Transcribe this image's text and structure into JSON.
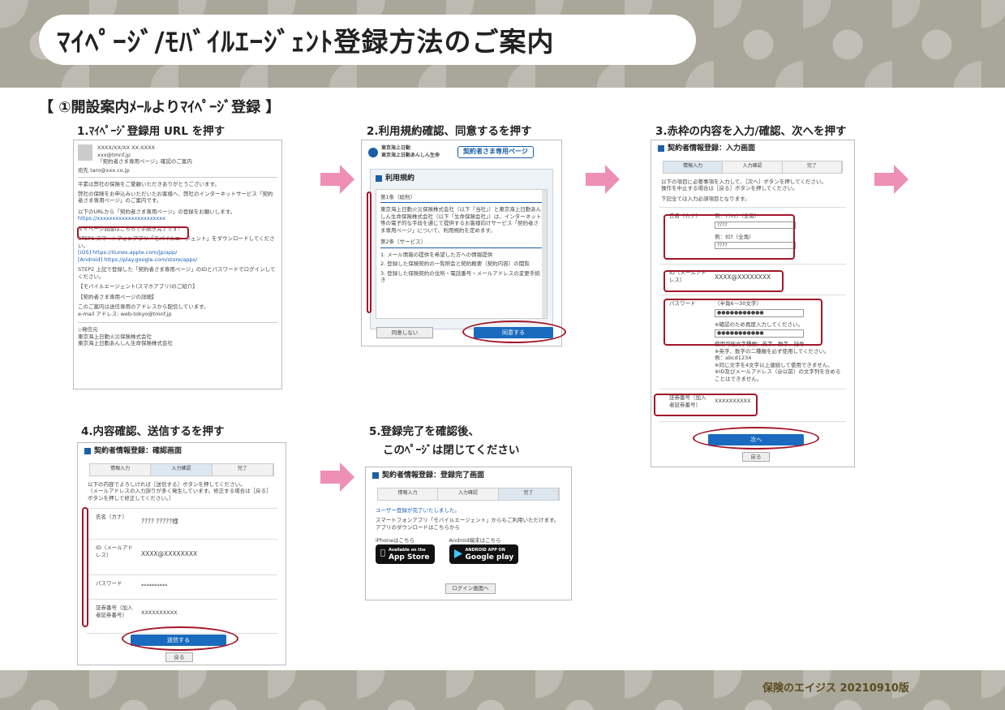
{
  "title": "ﾏｲﾍﾟｰｼﾞ/ﾓﾊﾞｲﾙｴｰｼﾞｪﾝﾄ登録方法のご案内",
  "section": "【 ①開設案内ﾒｰﾙよりﾏｲﾍﾟｰｼﾞ登録 】",
  "steps": [
    "1.ﾏｲﾍﾟｰｼﾞ登録用 URL を押す",
    "2.利用規約確認、同意するを押す",
    "3.赤枠の内容を入力/確認、次へを押す",
    "4.内容確認、送信するを押す",
    "5.登録完了を確認後、",
    "このﾍﾟｰｼﾞは閉じてください"
  ],
  "footer": "保険のエイジス 20210910版",
  "colors": {
    "band": "#a9a79a",
    "arrow": "#ee8fb6",
    "ring": "#a3162a",
    "button": "#1a6bbf"
  },
  "email": {
    "date": "XXXX/XX/XX XX:XXXX",
    "from": "xxx@tmnf.jp",
    "subject": "「契約者さま専用ページ」確認のご案内",
    "to_label": "宛先",
    "to": "taro@xxx.co.jp",
    "body1": "平素は弊社の保険をご愛顧いただきありがとうございます。",
    "body2": "弊社の保険をお申込みいただいたお客様へ、弊社のインターネットサービス「契約者さま専用ページ」のご案内です。",
    "url_intro": "以下のURLから「契約者さま専用ページ」の登録をお願いします。",
    "url": "https://xxxxxxxxxxxxxxxxxxxxxx",
    "mypage": "マイページ開設はこちらで手続き完了です！",
    "step1": "STEP1 スマートフォンアプリ「モバイルエージェント」をダウンロードしてください。",
    "ios": "[iOS] https://itunes.apple.com/jp/app/",
    "android": "[Android] https://play.google.com/store/apps/",
    "step2": "STEP2 上記で登録した「契約者さま専用ページ」のIDとパスワードでログインしてください。",
    "mobile": "【モバイルエージェント(スマホアプリ)のご紹介】",
    "detail": "【契約者さま専用ページの詳細】",
    "note": "このご案内は送信専用のアドレスから配信しています。",
    "email_line": "e-mail アドレス: web-tokyo@tmnf.jp",
    "sender_label": "◇発信元",
    "sender1": "東京海上日動火災保険株式会社",
    "sender2": "東京海上日動あんしん生命保険株式会社"
  },
  "terms": {
    "logo1": "東京海上日動",
    "logo2": "東京海上日動あんしん生命",
    "banner": "契約者さま専用ページ",
    "heading": "利用規約",
    "art1": "第1条（総則）",
    "text1": "東京海上日動火災保険株式会社（以下「当社」）と東京海上日動あんしん生命保険株式会社（以下「生命保険会社」）は、インターネット等の電子的な手段を通じて提供するお客様向けサービス「契約者さま専用ページ」について、利用規約を定めます。",
    "art2": "第2条（サービス）",
    "text2a": "1. メール情報の提供を希望した方への情報提供",
    "text2b": "2. 登録した保険契約の一覧照会と契約概要（契約内容）の閲覧",
    "text2c": "3. 登録した保険契約の住所・電話番号・メールアドレスの変更手続き",
    "disagree": "同意しない",
    "agree": "同意する"
  },
  "form": {
    "heading": "契約者情報登録：入力画面",
    "tabs": [
      "情報入力",
      "入力確認",
      "完了"
    ],
    "intro": "以下の項目に必要事項を入力して、［次へ］ボタンを押してください。",
    "intro2": "操作を中止する場合は［戻る］ボタンを押してください。",
    "required": "下記全ては入力必須項目となります。",
    "name_label": "氏名（カナ）",
    "ex1": "例：ﾄｳｷｮｳ（全角）",
    "ex2": "例：ﾀﾛｳ（全角）",
    "mask": "????",
    "id_label": "ID（メールアドレス）",
    "id_value": "XXXX@XXXXXXXX",
    "pw_label": "パスワード",
    "pw_hint": "（半角6〜30文字）",
    "pw_value": "●●●●●●●●●●●",
    "pw_confirm": "※確認のため再度入力してください。",
    "pw_rules1": "使用可能文字種類：英字、数字、記号",
    "pw_rules2": "※英字、数字の二種類を必ず使用してください。",
    "pw_rules3": "例：abcd1234",
    "pw_rules4": "※同じ文字を4文字以上連続して使用できません。",
    "pw_rules5": "※ID及びメールアドレス（@以前）の文字列を含めることはできません。",
    "cert_label": "証券番号（加入者証券番号）",
    "cert_value": "XXXXXXXXXX",
    "next": "次へ",
    "back": "戻る"
  },
  "confirm": {
    "heading": "契約者情報登録：確認画面",
    "tabs": [
      "情報入力",
      "入力確認",
      "完了"
    ],
    "intro": "以下の内容でよろしければ［送信する］ボタンを押してください。",
    "intro2": "（メールアドレスの入力誤りが多く発生しています。修正する場合は［戻る］ボタンを押して修正してください。）",
    "name_label": "氏名（カナ）",
    "name_value": "???? ?????様",
    "id_label": "ID（メールアドレス）",
    "id_value": "XXXX@XXXXXXXX",
    "pw_label": "パスワード",
    "pw_value": "**********",
    "cert_label": "証券番号（加入者証券番号）",
    "cert_value": "XXXXXXXXXX",
    "send": "送信する",
    "back": "戻る"
  },
  "done": {
    "heading": "契約者情報登録：登録完了画面",
    "tabs": [
      "情報入力",
      "入力確認",
      "完了"
    ],
    "link": "ユーザー登録が完了いたしました。",
    "text1": "スマートフォンアプリ「モバイルエージェント」からもご利用いただけます。",
    "text2": "アプリのダウンロードはこちらから",
    "iphone": "iPhoneはこちら",
    "android": "Android端末はこちら",
    "appstore_small": "Available on the",
    "appstore": "App Store",
    "gplay_small": "ANDROID APP ON",
    "gplay": "Google play",
    "login": "ログイン画面へ"
  }
}
